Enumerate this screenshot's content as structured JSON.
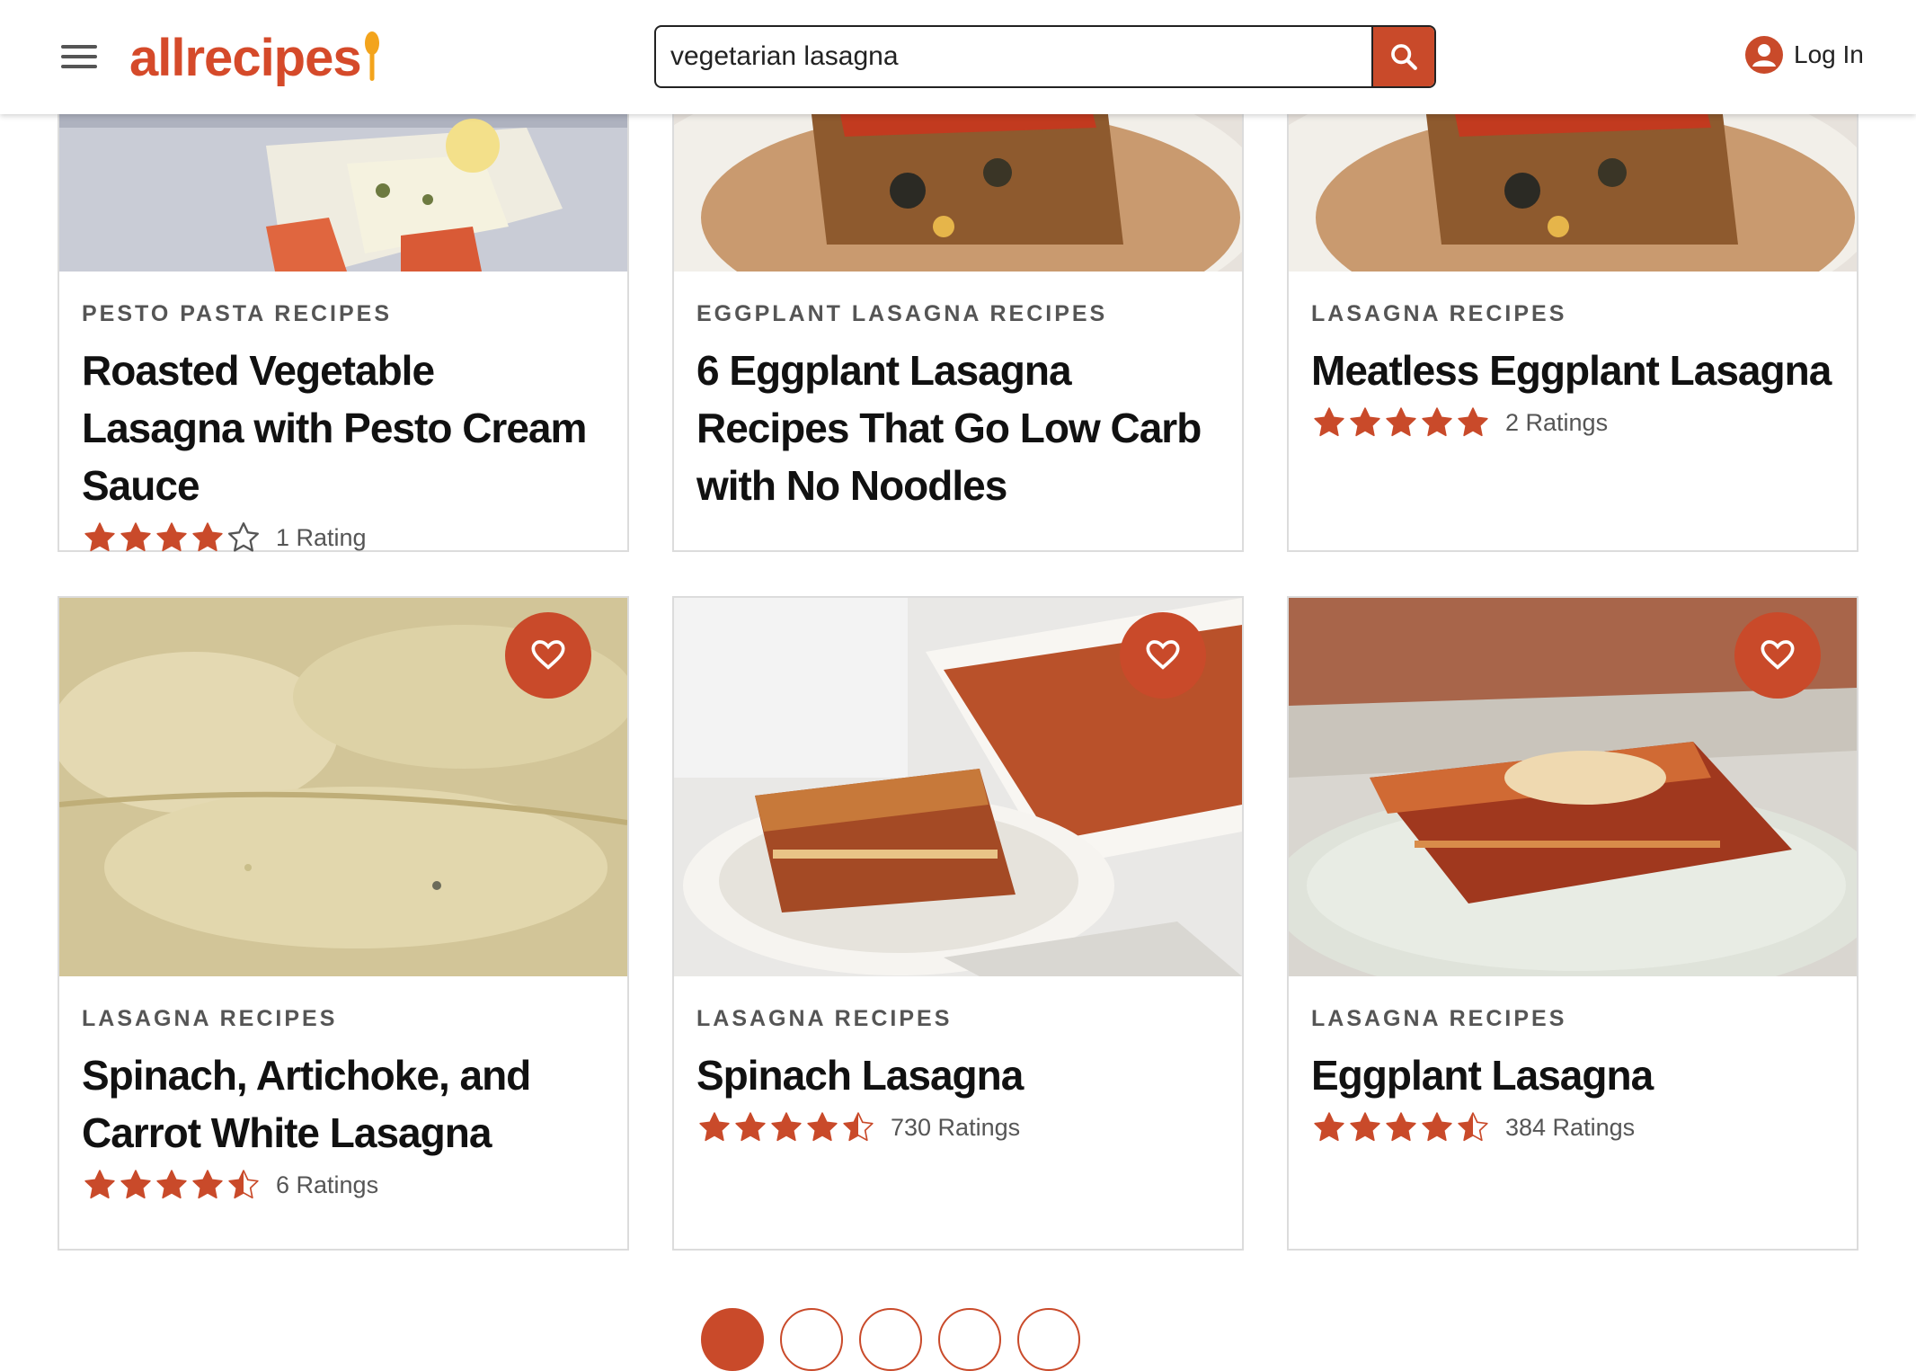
{
  "header": {
    "logo_text": "allrecipes",
    "search": {
      "value": "vegetarian lasagna"
    },
    "login_label": "Log In"
  },
  "colors": {
    "brand": "#d54a2a",
    "button": "#c94a2a",
    "star": "#c94a2a"
  },
  "cards": [
    {
      "category": "PESTO PASTA RECIPES",
      "title": "Roasted Vegetable Lasagna with Pesto Cream Sauce",
      "stars": 4,
      "rating_text": "1 Rating"
    },
    {
      "category": "EGGPLANT LASAGNA RECIPES",
      "title": "6 Eggplant Lasagna Recipes That Go Low Carb with No Noodles"
    },
    {
      "category": "LASAGNA RECIPES",
      "title": "Meatless Eggplant Lasagna",
      "stars": 5,
      "rating_text": "2 Ratings"
    },
    {
      "category": "LASAGNA RECIPES",
      "title": "Spinach, Artichoke, and Carrot White Lasagna",
      "stars": 4.5,
      "rating_text": "6 Ratings"
    },
    {
      "category": "LASAGNA RECIPES",
      "title": "Spinach Lasagna",
      "stars": 4.5,
      "rating_text": "730 Ratings"
    },
    {
      "category": "LASAGNA RECIPES",
      "title": "Eggplant Lasagna",
      "stars": 4.5,
      "rating_text": "384 Ratings"
    }
  ],
  "pagination": {
    "current_page": 1,
    "page_count": 5
  }
}
